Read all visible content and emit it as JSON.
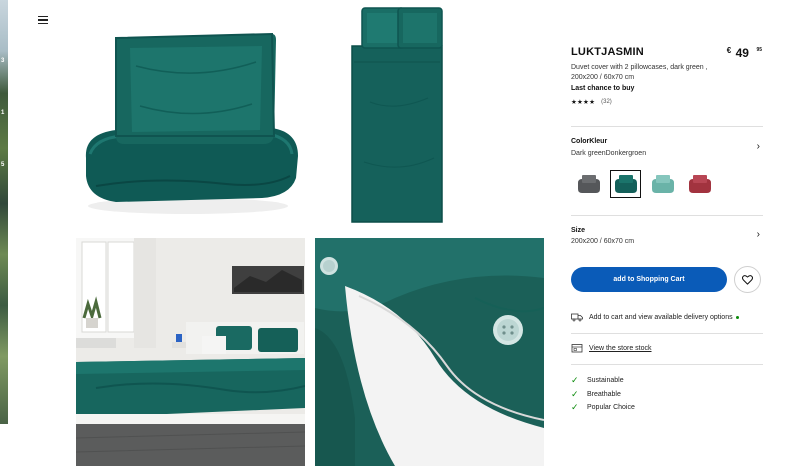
{
  "product": {
    "name": "LUKTJASMIN",
    "price_currency": "€",
    "price_integer": "49",
    "price_decimal": "95",
    "description": "Duvet cover with 2 pillowcases, dark green , 200x200 / 60x70 cm",
    "availability": "Last chance to buy",
    "rating_stars": "★★★★",
    "rating_value": 4,
    "review_count": "(32)"
  },
  "color": {
    "label": "ColorKleur",
    "value": "Dark greenDonkergroen",
    "swatches": [
      {
        "name": "dark grey",
        "color": "#5a5b5c"
      },
      {
        "name": "dark green",
        "color": "#17605c",
        "selected": true
      },
      {
        "name": "light turquoise",
        "color": "#6fb8ad"
      },
      {
        "name": "red",
        "color": "#a53843"
      }
    ]
  },
  "size": {
    "label": "Size",
    "value": "200x200 / 60x70 cm"
  },
  "actions": {
    "add_to_cart": "add to Shopping Cart",
    "favourite_icon": "heart-icon"
  },
  "delivery": {
    "text": "Add to cart and view available delivery options",
    "icon": "truck-icon"
  },
  "store": {
    "text": "View the store stock",
    "icon": "store-icon"
  },
  "features": [
    "Sustainable",
    "Breathable",
    "Popular Choice"
  ],
  "colors": {
    "accent_blue": "#0a5bb8",
    "check_green": "#0a8a0a",
    "product_teal": "#17605c"
  }
}
